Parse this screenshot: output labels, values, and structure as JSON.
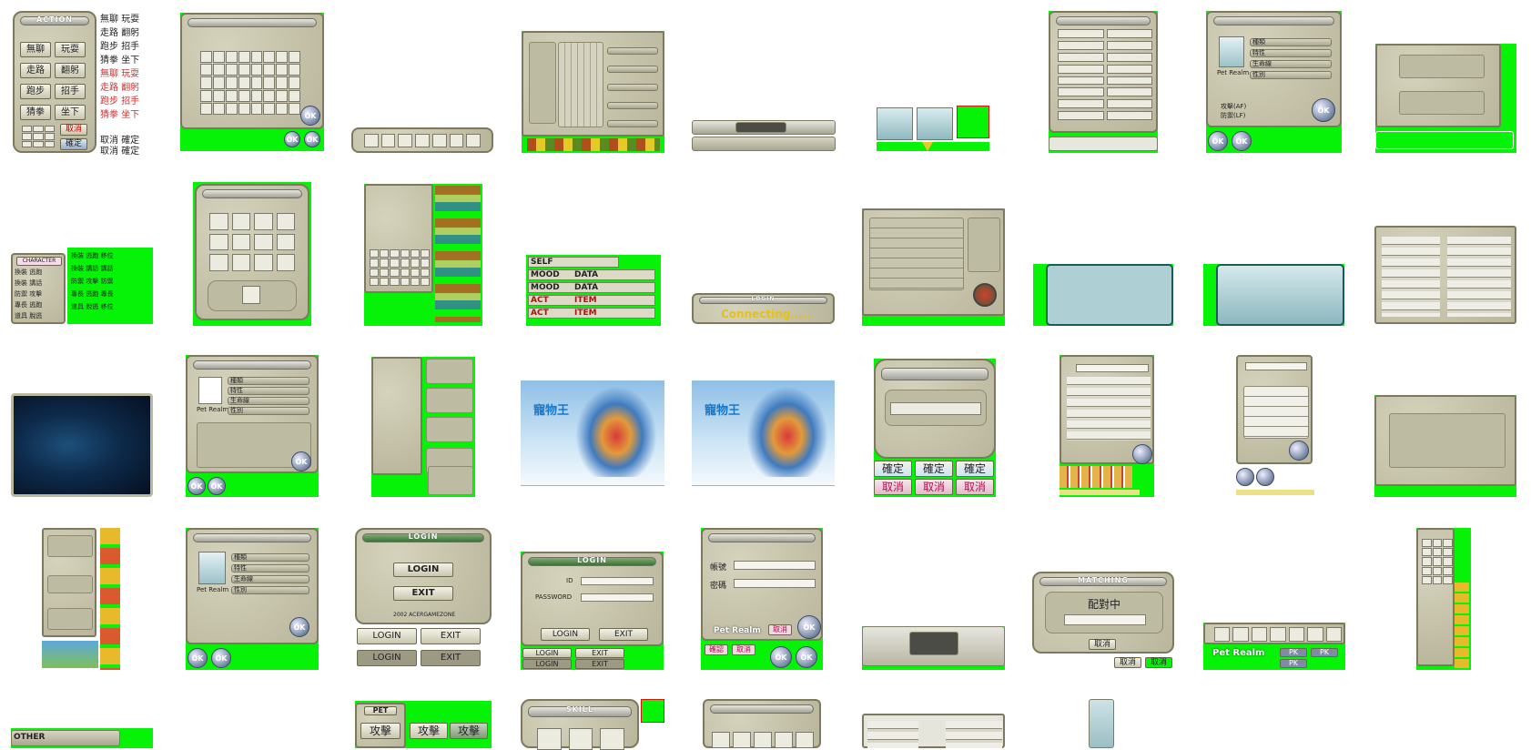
{
  "colors": {
    "chroma_green": "#06f206",
    "panel_stone": "#c9c6ae",
    "bubble_teal": "#aecfd3",
    "ok_orb": "#7c8da8"
  },
  "action_panel": {
    "title": "ACTION",
    "buttons": [
      "無聊",
      "玩耍",
      "走路",
      "翻躬",
      "跑步",
      "招手",
      "猜拳",
      "坐下"
    ],
    "cancel": "取消",
    "confirm": "確定",
    "side_row1": [
      "無聊",
      "玩耍"
    ],
    "side_row2": [
      "走路",
      "翻躬"
    ],
    "side_row3": [
      "跑步",
      "招手"
    ],
    "side_row4": [
      "猜拳",
      "坐下"
    ],
    "side_row5": [
      "無聊",
      "玩耍"
    ],
    "side_row6": [
      "走路",
      "翻躬"
    ],
    "side_row7": [
      "跑步",
      "招手"
    ],
    "side_row8": [
      "猜拳",
      "坐下"
    ],
    "side_cancel_confirm_1": [
      "取消",
      "確定"
    ],
    "side_cancel_confirm_2": [
      "取消",
      "確定"
    ]
  },
  "item_panel": {
    "title": "ITEM",
    "ok": "OK"
  },
  "connecting": {
    "title": "LOGIN",
    "status": "Connecting....."
  },
  "mood_panel": {
    "rows": [
      {
        "tag": "SELF",
        "label": ""
      },
      {
        "tag": "MOOD",
        "label": "DATA"
      },
      {
        "tag": "MOOD",
        "label": "DATA"
      },
      {
        "tag": "ACT",
        "label": "ITEM"
      },
      {
        "tag": "ACT",
        "label": "ITEM"
      }
    ]
  },
  "character_panel": {
    "tag": "CHARACTER",
    "left": [
      [
        "換裝",
        "逃跑"
      ],
      [
        "換裝",
        "講話"
      ],
      [
        "防禦",
        "攻擊"
      ],
      [
        "專長",
        "逃跑"
      ],
      [
        "道具",
        "脫逃"
      ]
    ],
    "right": [
      [
        "換裝",
        "逃跑"
      ],
      [
        "換裝",
        "講話"
      ],
      [
        "防禦",
        "攻擊"
      ],
      [
        "專長",
        "逃跑"
      ],
      [
        "道具",
        "脫逃"
      ]
    ],
    "far": [
      "移位",
      "講話",
      "防禦",
      "專長",
      "移位"
    ]
  },
  "pet_card": {
    "fields": [
      "種類",
      "特性",
      "生命線",
      "性別"
    ],
    "logo": "Pet Realm",
    "ok": "OK"
  },
  "pet_card_alt": {
    "fields": [
      "種類",
      "特性",
      "生命線",
      "性別"
    ],
    "logo": "Pet Realm",
    "info1": "攻擊(AF)",
    "info2": "防禦(LF)",
    "ok": "OK"
  },
  "confirm_buttons": {
    "confirm": "確定",
    "cancel": "取消"
  },
  "login_big": {
    "title": "LOGIN",
    "login": "LOGIN",
    "exit": "EXIT",
    "footer": "2002 ACERGAMEZONE"
  },
  "login_small": {
    "title": "LOGIN",
    "id_label": "ID",
    "password_label": "PASSWORD",
    "login": "LOGIN",
    "exit": "EXIT"
  },
  "login_zh": {
    "title": "LOGIN",
    "account": "帳號",
    "password": "密碼",
    "logo": "Pet Realm",
    "cancel": "取消",
    "confirm": "確認",
    "ok": "OK"
  },
  "matching": {
    "title": "MATCHING",
    "status": "配對中",
    "cancel": "取消"
  },
  "pk_bar": {
    "logo": "Pet Realm",
    "pk": "PK"
  },
  "pet_buttons": {
    "tag": "PET",
    "attack": "攻擊"
  },
  "skill_panel": {
    "title": "SKILL"
  },
  "other_bar": {
    "tag": "OTHER"
  },
  "game_title": "寵物王"
}
